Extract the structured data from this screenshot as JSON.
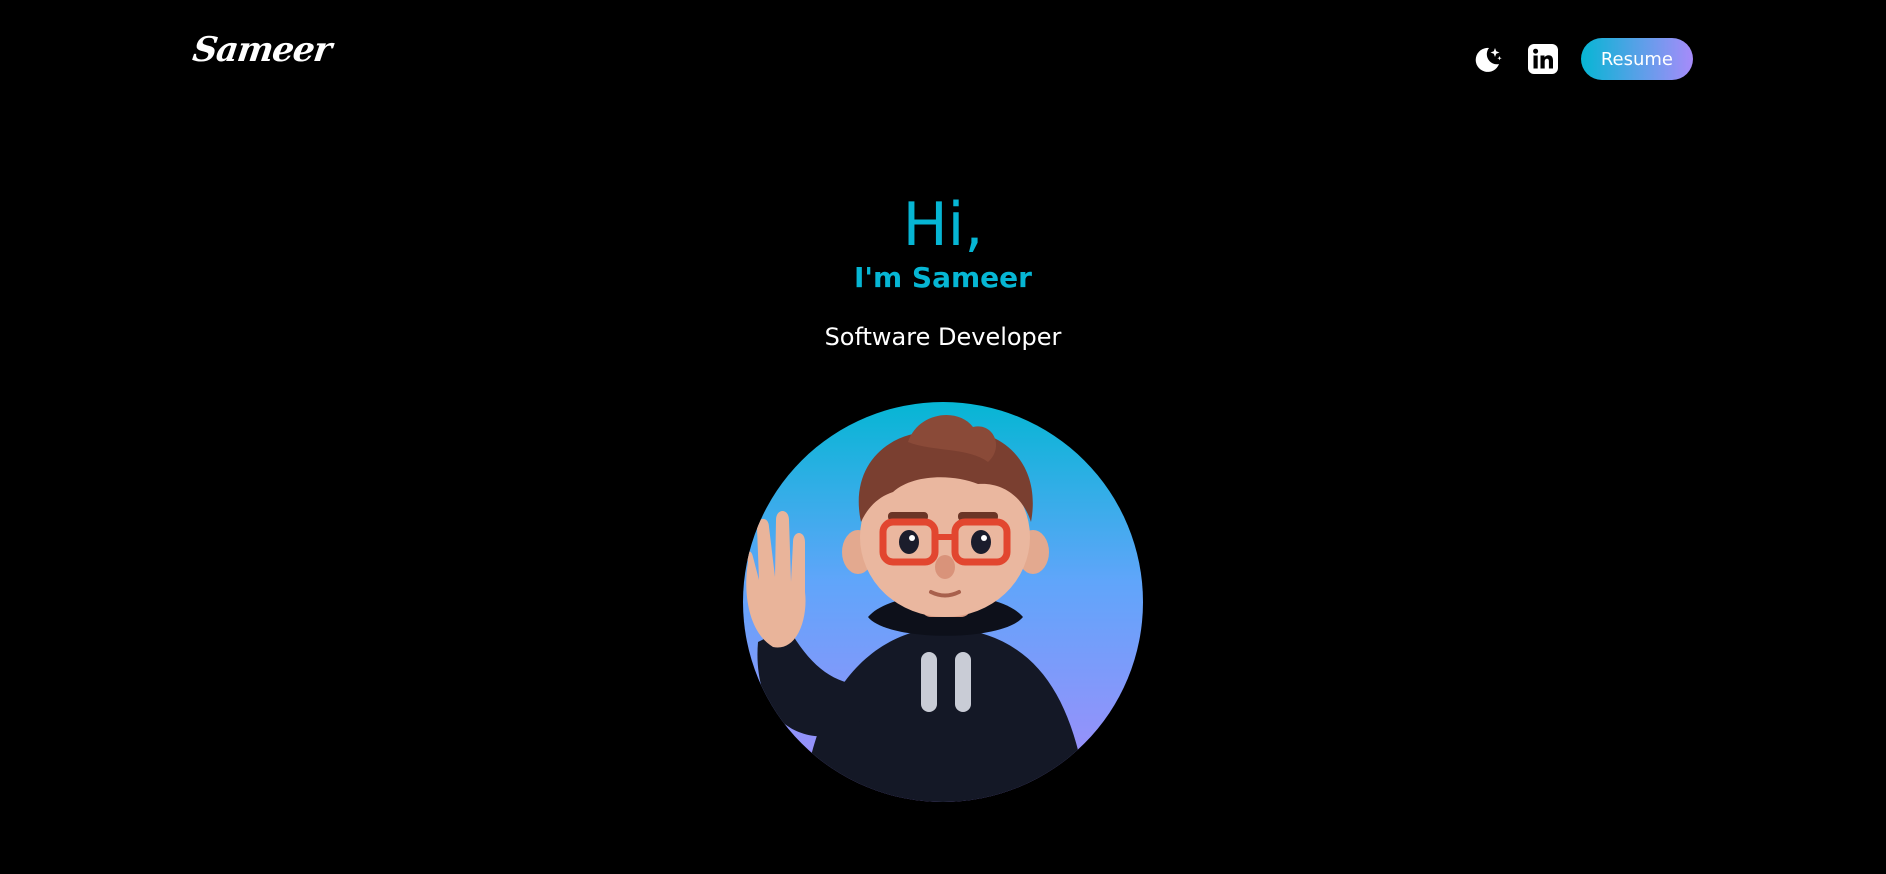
{
  "nav": {
    "logo_text": "Sameer",
    "theme_toggle_icon": "moon-stars-icon",
    "linkedin_icon": "linkedin-icon",
    "resume_label": "Resume"
  },
  "hero": {
    "greeting": "Hi,",
    "name": "I'm Sameer",
    "role": "Software Developer",
    "avatar_icon": "avatar-3d-character"
  },
  "colors": {
    "background": "#000000",
    "accent": "#06b6d4",
    "gradient_start": "#06b6d4",
    "gradient_end": "#a78bfa",
    "text": "#ffffff"
  }
}
